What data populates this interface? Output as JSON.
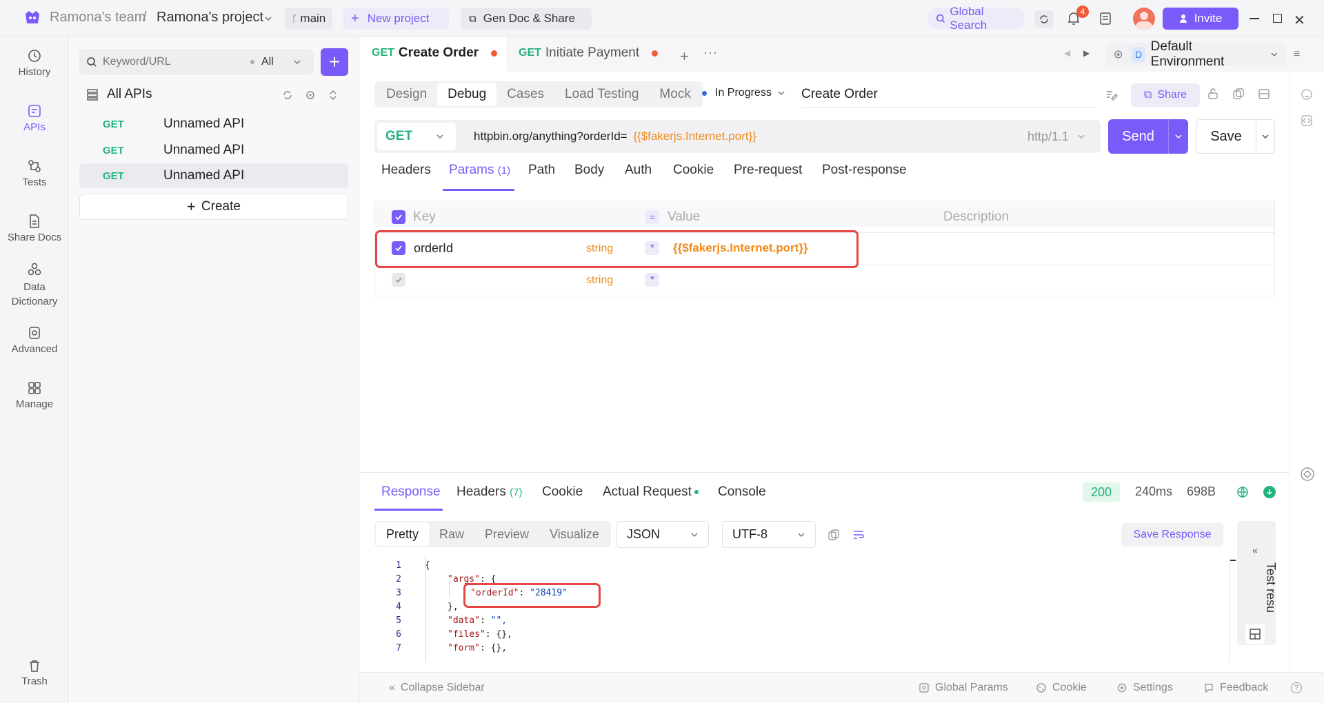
{
  "topbar": {
    "team": "Ramona's team",
    "separator": "/",
    "project": "Ramona's project",
    "branch": "main",
    "new_project": "New project",
    "gen_doc": "Gen Doc & Share",
    "global_search": "Global Search",
    "notifications_count": "4",
    "invite": "Invite"
  },
  "rail": {
    "items": [
      {
        "label": "History",
        "icon": "history-icon"
      },
      {
        "label": "APIs",
        "icon": "apis-icon",
        "active": true
      },
      {
        "label": "Tests",
        "icon": "tests-icon"
      },
      {
        "label": "Share Docs",
        "icon": "share-docs-icon"
      },
      {
        "label": "Data Dictionary",
        "icon": "data-dictionary-icon"
      },
      {
        "label": "Advanced",
        "icon": "advanced-icon"
      },
      {
        "label": "Manage",
        "icon": "manage-icon"
      }
    ],
    "trash": "Trash"
  },
  "sidebar": {
    "search_placeholder": "Keyword/URL",
    "filter": "All",
    "all_apis": "All APIs",
    "apis": [
      {
        "method": "GET",
        "name": "Unnamed API"
      },
      {
        "method": "GET",
        "name": "Unnamed API"
      },
      {
        "method": "GET",
        "name": "Unnamed API",
        "selected": true
      }
    ],
    "create": "Create"
  },
  "tabs": [
    {
      "method": "GET",
      "name": "Create Order",
      "active": true
    },
    {
      "method": "GET",
      "name": "Initiate Payment"
    }
  ],
  "environment": {
    "badge": "D",
    "name": "Default Environment"
  },
  "mode_tabs": [
    "Design",
    "Debug",
    "Cases",
    "Load Testing",
    "Mock"
  ],
  "active_mode": "Debug",
  "status": "In Progress",
  "api_name": "Create Order",
  "share": "Share",
  "request": {
    "method": "GET",
    "url_prefix": "httpbin.org/anything?orderId=",
    "url_var": "{{$fakerjs.Internet.port}}",
    "protocol": "http/1.1",
    "send": "Send",
    "save": "Save"
  },
  "request_tabs": [
    "Headers",
    "Params",
    "Path",
    "Body",
    "Auth",
    "Cookie",
    "Pre-request",
    "Post-response"
  ],
  "params_count": "(1)",
  "params_table": {
    "headers": {
      "key": "Key",
      "value": "Value",
      "description": "Description"
    },
    "rows": [
      {
        "key": "orderId",
        "type": "string",
        "required": "*",
        "value": "{{$fakerjs.Internet.port}}",
        "checked": true
      },
      {
        "key": "",
        "type": "string",
        "required": "*",
        "value": "",
        "checked": false
      }
    ]
  },
  "response": {
    "tabs": [
      "Response",
      "Headers",
      "Cookie",
      "Actual Request",
      "Console"
    ],
    "headers_count": "(7)",
    "status_code": "200",
    "time": "240ms",
    "size": "698B",
    "view_tabs": [
      "Pretty",
      "Raw",
      "Preview",
      "Visualize"
    ],
    "format": "JSON",
    "encoding": "UTF-8",
    "save_response": "Save Response",
    "test_results": "Test resu",
    "code_lines": [
      {
        "n": "1",
        "text": "{"
      },
      {
        "n": "2",
        "key": "\"args\"",
        "rest": ": {"
      },
      {
        "n": "3",
        "key": "\"orderId\"",
        "rest": ": ",
        "str": "\"28419\""
      },
      {
        "n": "4",
        "text": "},"
      },
      {
        "n": "5",
        "key": "\"data\"",
        "rest": ": ",
        "str": "\"\","
      },
      {
        "n": "6",
        "key": "\"files\"",
        "rest": ": {},"
      },
      {
        "n": "7",
        "key": "\"form\"",
        "rest": ": {},"
      }
    ]
  },
  "bottom_bar": {
    "collapse": "Collapse Sidebar",
    "global_params": "Global Params",
    "cookie": "Cookie",
    "settings": "Settings",
    "feedback": "Feedback"
  },
  "colors": {
    "accent": "#7a5af8",
    "get": "#22b37a",
    "variable": "#f08a1a",
    "highlight": "#e74444"
  }
}
